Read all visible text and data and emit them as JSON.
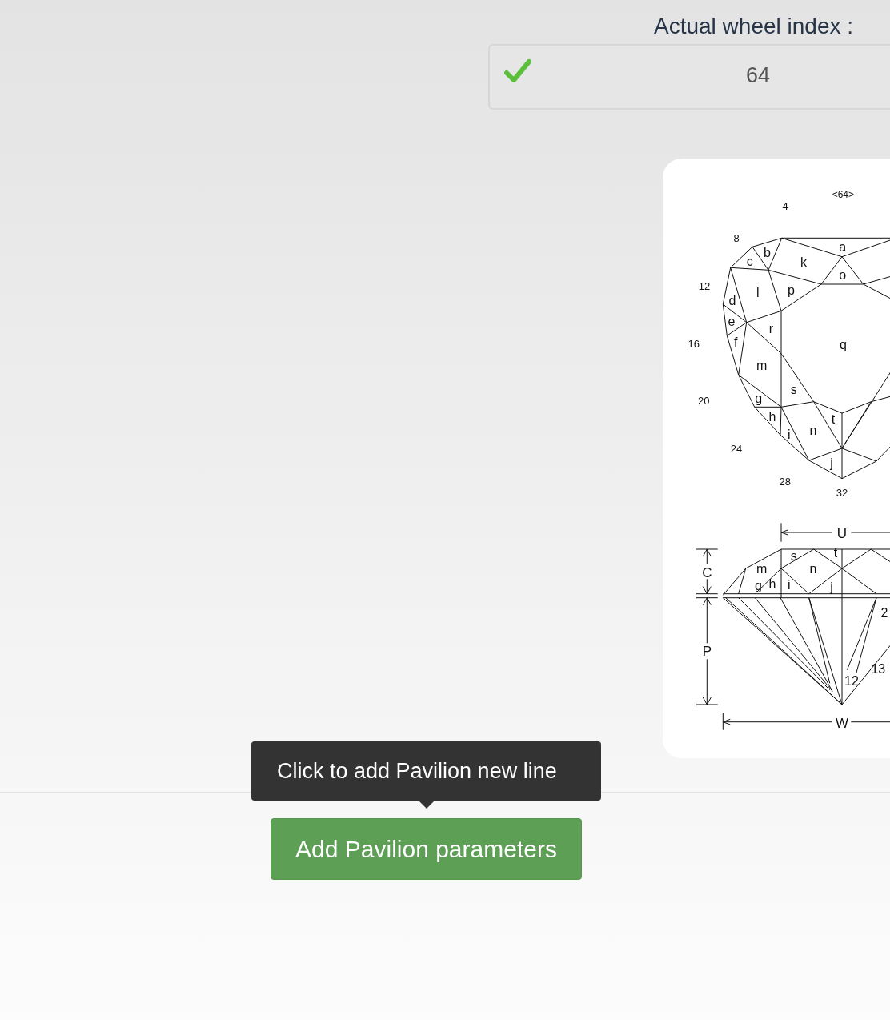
{
  "wheel_index": {
    "label": "Actual wheel index :",
    "value": "64",
    "valid": true
  },
  "diagram": {
    "top_view": {
      "index_label": "<64>",
      "angle_marks": [
        "4",
        "8",
        "12",
        "16",
        "20",
        "24",
        "28",
        "32"
      ],
      "facet_labels": [
        "a",
        "b",
        "c",
        "k",
        "o",
        "l",
        "p",
        "d",
        "e",
        "r",
        "f",
        "q",
        "m",
        "s",
        "g",
        "h",
        "t",
        "n",
        "i",
        "j"
      ]
    },
    "side_view": {
      "dimension_labels": [
        "U",
        "C",
        "P",
        "W"
      ],
      "facet_labels": [
        "s",
        "t",
        "m",
        "n",
        "g",
        "h",
        "i",
        "j",
        "2",
        "12",
        "13"
      ]
    }
  },
  "tooltip": {
    "text": "Click to add Pavilion new line"
  },
  "add_button": {
    "label": "Add Pavilion parameters"
  }
}
